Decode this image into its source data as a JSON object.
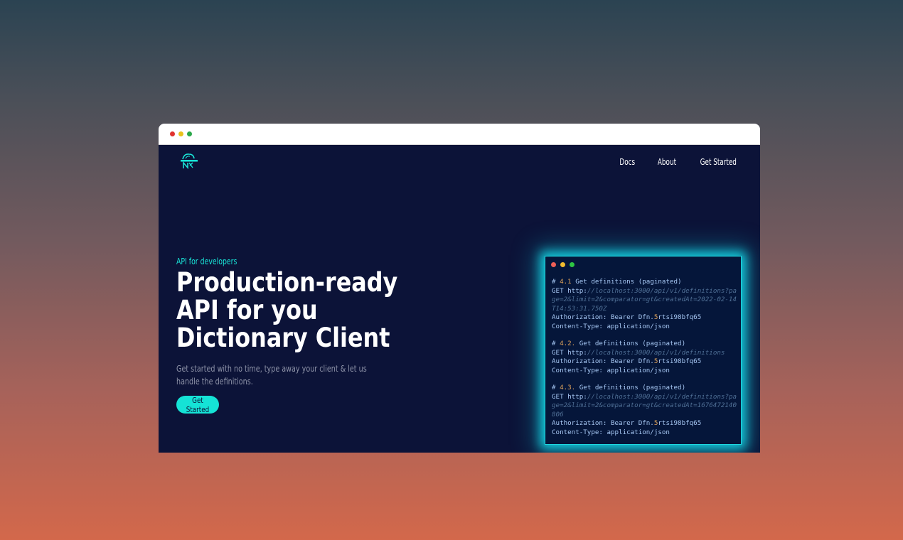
{
  "nav": {
    "items": [
      "Docs",
      "About",
      "Get Started"
    ]
  },
  "hero": {
    "eyebrow": "API for developers",
    "headline": "Production-ready API for you Dictionary Client",
    "subtext": "Get started with no time, type away your client & let us handle the definitions.",
    "cta": "Get Started"
  },
  "code": {
    "blocks": [
      {
        "heading_prefix": "# ",
        "heading_num": "4.1",
        "heading_text": " Get definitions (paginated)",
        "method": "GET ",
        "scheme": "http:",
        "url": "//localhost:3000/api/v1/definitions?page=2&limit=2&comparator=gt&createdAt=2022-02-14T14:53:31.750Z",
        "auth_prefix": "Authorization: Bearer Dfn.",
        "auth_token_num": "5",
        "auth_token_rest": "rtsi98bfq65",
        "content_type": "Content-Type: application/json"
      },
      {
        "heading_prefix": "# ",
        "heading_num": "4.2.",
        "heading_text": " Get definitions (paginated)",
        "method": "GET ",
        "scheme": "http:",
        "url": "//localhost:3000/api/v1/definitions",
        "auth_prefix": "Authorization: Bearer Dfn.",
        "auth_token_num": "5",
        "auth_token_rest": "rtsi98bfq65",
        "content_type": "Content-Type: application/json"
      },
      {
        "heading_prefix": "# ",
        "heading_num": "4.3.",
        "heading_text": " Get definitions (paginated)",
        "method": "GET ",
        "scheme": "http:",
        "url": "//localhost:3000/api/v1/definitions?page=2&limit=2&comparator=gt&createdAt=1676472140806",
        "auth_prefix": "Authorization: Bearer Dfn.",
        "auth_token_num": "5",
        "auth_token_rest": "rtsi98bfq65",
        "content_type": "Content-Type: application/json"
      }
    ]
  },
  "colors": {
    "page_bg": "#0c1338",
    "accent": "#15e3d6",
    "code_bg": "#05163a"
  }
}
